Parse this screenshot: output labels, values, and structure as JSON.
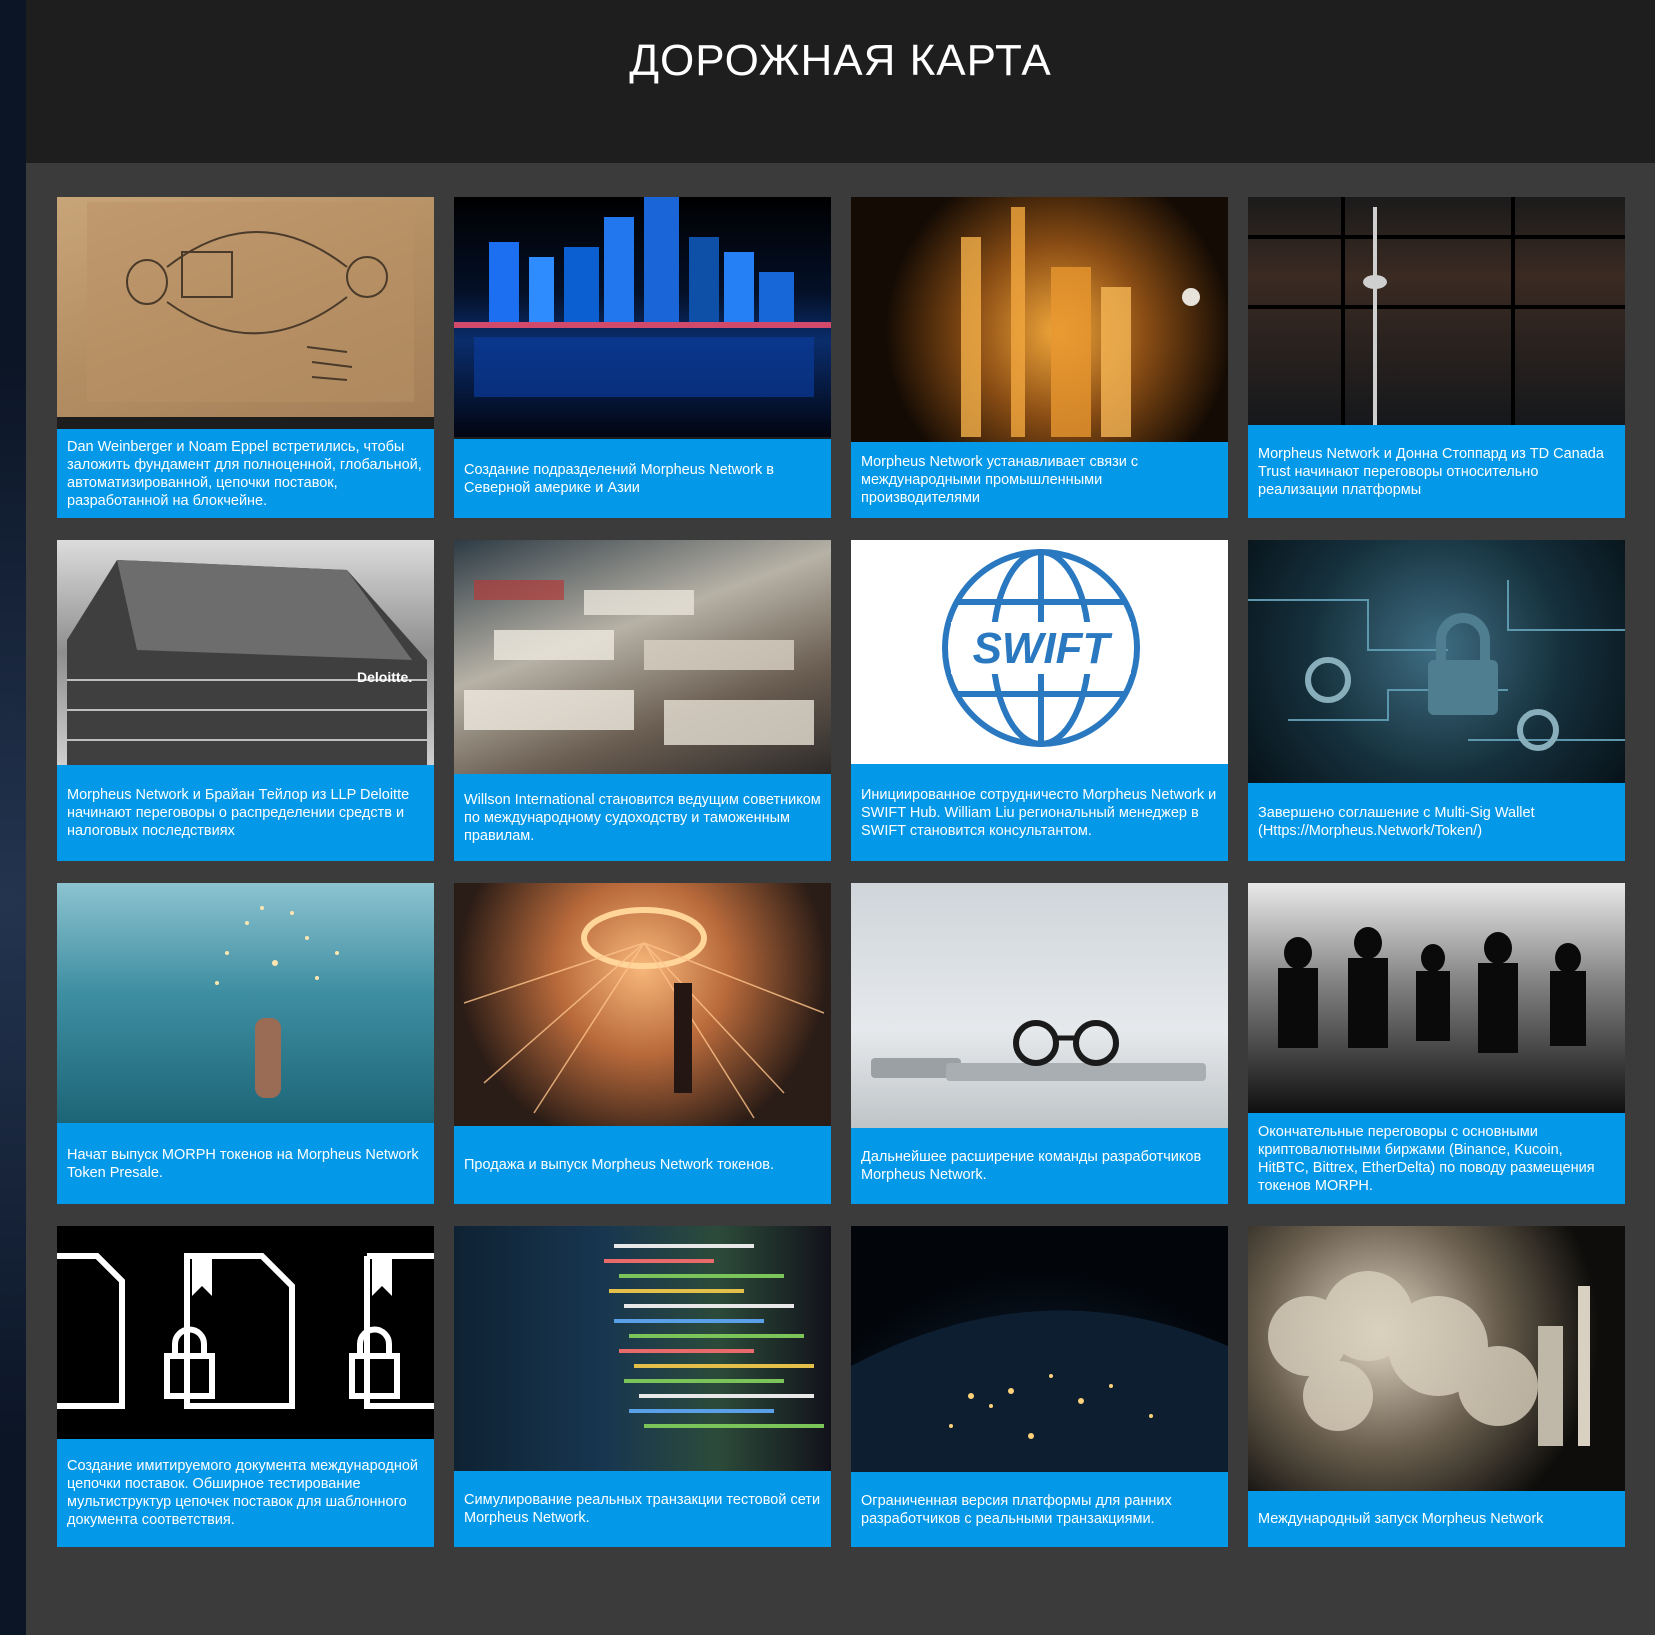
{
  "header": {
    "title": "ДОРОЖНАЯ КАРТА"
  },
  "cards": [
    {
      "image": "napkin-sketch",
      "caption": "Dan Weinberger и Noam Eppel встретились, чтобы заложить фундамент для полноценной, глобальной, автоматизированной, цепочки поставок, разработанной на блокчейне."
    },
    {
      "image": "night-city-skyline",
      "caption": "Создание подразделений Morpheus Network в Северной америке и Азии"
    },
    {
      "image": "industrial-plant-night",
      "caption": "Morpheus Network устанавливает связи с международными промышленными производителями"
    },
    {
      "image": "cn-tower-through-glass",
      "caption": "Morpheus Network и Донна Стоппард из TD Canada Trust начинают переговоры относительно реализации платформы"
    },
    {
      "image": "deloitte-building",
      "caption": "Morpheus Network и Брайан Тейлор из LLP Deloitte начинают переговоры о распределении средств и налоговых последствиях"
    },
    {
      "image": "container-port",
      "caption": "Willson International становится ведущим советником по международному судоходству и таможенным правилам."
    },
    {
      "image": "swift-logo",
      "caption": "Инициированное сотрудничесто Morpheus Network и SWIFT Hub. William Liu региональный менеджер в SWIFT становится консультантом."
    },
    {
      "image": "circuit-keys-padlock",
      "caption": "Завершено соглашение с Multi-Sig Wallet (Https://Morpheus.Network/Token/)"
    },
    {
      "image": "sparkler-in-sea",
      "caption": "Начат выпуск MORPH токенов на Morpheus Network Token Presale."
    },
    {
      "image": "steel-wool-sparks",
      "caption": "Продажа и выпуск Morpheus Network токенов."
    },
    {
      "image": "glasses-on-laptop",
      "caption": "Дальнейшее расширение команды разработчиков Morpheus Network."
    },
    {
      "image": "meeting-silhouettes",
      "caption": "Окончательные переговоры с основными криптовалютными биржами (Binance, Kucoin, HitBTC, Bittrex, EtherDelta) по поводу размещения токенов MORPH."
    },
    {
      "image": "document-lock-icons",
      "caption": "Создание имитируемого документа международной цепочки поставок. Обширное тестирование мультиструктур цепочек поставок для шаблонного документа соответствия."
    },
    {
      "image": "code-screen",
      "caption": "Симулирование реальных транзакции тестовой сети Morpheus Network."
    },
    {
      "image": "earth-night-lights",
      "caption": "Ограниченная версия платформы для ранних разработчиков с реальными транзакциями."
    },
    {
      "image": "rocket-launch-smoke",
      "caption": "Международный запуск Morpheus Network"
    }
  ],
  "swift_logo_text": "SWIFT",
  "deloitte_sign": "Deloitte.",
  "colors": {
    "caption_bg": "#0399e8",
    "header_bg": "#1e1e1e",
    "page_bg": "#3b3b3b",
    "swift_blue": "#2a78c0"
  }
}
